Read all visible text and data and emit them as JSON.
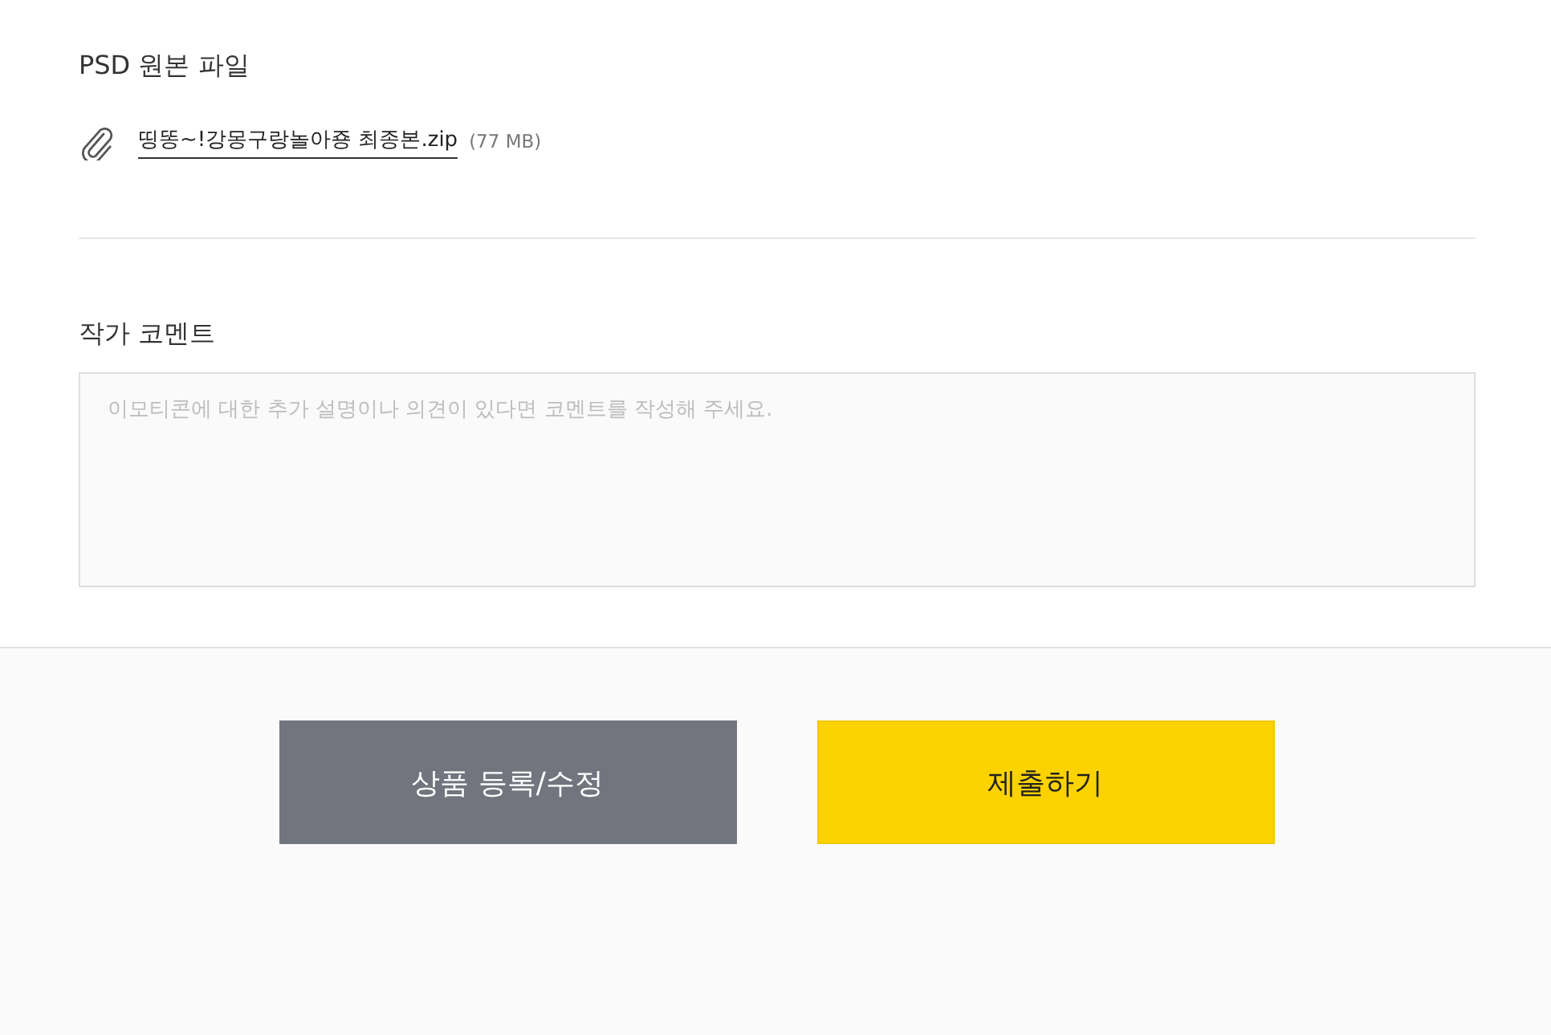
{
  "file_section": {
    "title": "PSD 원본 파일",
    "attachment": {
      "name": "띵똥~!강몽구랑놀아죵 최종본.zip",
      "size": "(77 MB)"
    }
  },
  "comment_section": {
    "title": "작가 코멘트",
    "field": {
      "placeholder": "이모티콘에 대한 추가 설명이나 의견이 있다면 코멘트를 작성해 주세요."
    }
  },
  "buttons": [
    {
      "label": "상품 등록/수정",
      "kind": "secondary"
    },
    {
      "label": "제출하기",
      "kind": "primary"
    }
  ]
}
